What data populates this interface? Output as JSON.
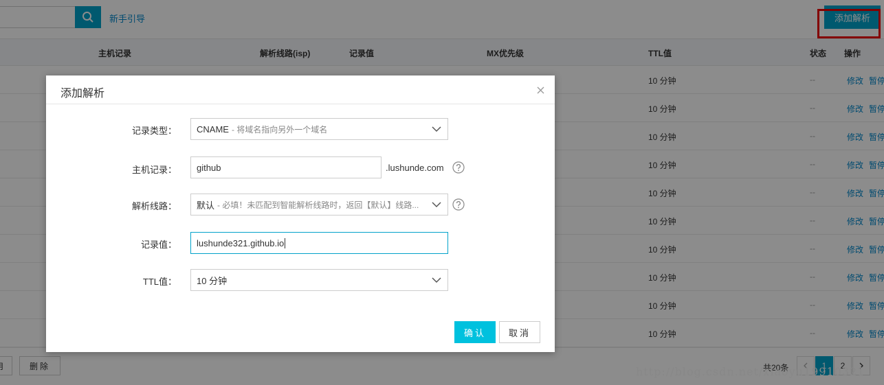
{
  "toolbar": {
    "search_placeholder": "",
    "guide_link": "新手引导",
    "add_button": "添加解析"
  },
  "table": {
    "columns": [
      "主机记录",
      "解析线路(isp)",
      "记录值",
      "MX优先级",
      "TTL值",
      "状态",
      "操作"
    ],
    "rows": [
      {
        "ttl": "10 分钟",
        "status": "--",
        "edit": "修改",
        "pause": "暂停"
      },
      {
        "ttl": "10 分钟",
        "status": "--",
        "edit": "修改",
        "pause": "暂停"
      },
      {
        "ttl": "10 分钟",
        "status": "--",
        "edit": "修改",
        "pause": "暂停"
      },
      {
        "ttl": "10 分钟",
        "status": "--",
        "edit": "修改",
        "pause": "暂停"
      },
      {
        "ttl": "10 分钟",
        "status": "--",
        "edit": "修改",
        "pause": "暂停"
      },
      {
        "ttl": "10 分钟",
        "status": "--",
        "edit": "修改",
        "pause": "暂停"
      },
      {
        "ttl": "10 分钟",
        "status": "--",
        "edit": "修改",
        "pause": "暂停"
      },
      {
        "ttl": "10 分钟",
        "status": "--",
        "edit": "修改",
        "pause": "暂停"
      },
      {
        "ttl": "10 分钟",
        "status": "--",
        "edit": "修改",
        "pause": "暂停"
      },
      {
        "ttl": "10 分钟",
        "status": "--",
        "edit": "修改",
        "pause": "暂停"
      }
    ]
  },
  "footer": {
    "left_button_partial": "用",
    "delete_button": "删除",
    "total": "共20条",
    "pages": [
      "1",
      "2"
    ],
    "current_page": "1",
    "watermark": "http://blog.csdn.net/xiaoyu19910321"
  },
  "modal": {
    "title": "添加解析",
    "record_type": {
      "label": "记录类型：",
      "value": "CNAME",
      "hint": "- 将域名指向另外一个域名"
    },
    "host": {
      "label": "主机记录：",
      "value": "github",
      "suffix": ".lushunde.com"
    },
    "line": {
      "label": "解析线路：",
      "value": "默认",
      "hint": "- 必填！未匹配到智能解析线路时，返回【默认】线路..."
    },
    "record_value": {
      "label": "记录值：",
      "value": "lushunde321.github.io"
    },
    "ttl": {
      "label": "TTL值：",
      "value": "10 分钟"
    },
    "confirm": "确认",
    "cancel": "取消"
  },
  "colors": {
    "accent": "#00a2ca",
    "confirm": "#00c1de",
    "link": "#0088cc",
    "highlight": "#e00000"
  },
  "icons": {
    "search": "search-icon",
    "close": "close-icon",
    "dropdown": "chevron-down-icon",
    "help": "help-circle-icon"
  }
}
